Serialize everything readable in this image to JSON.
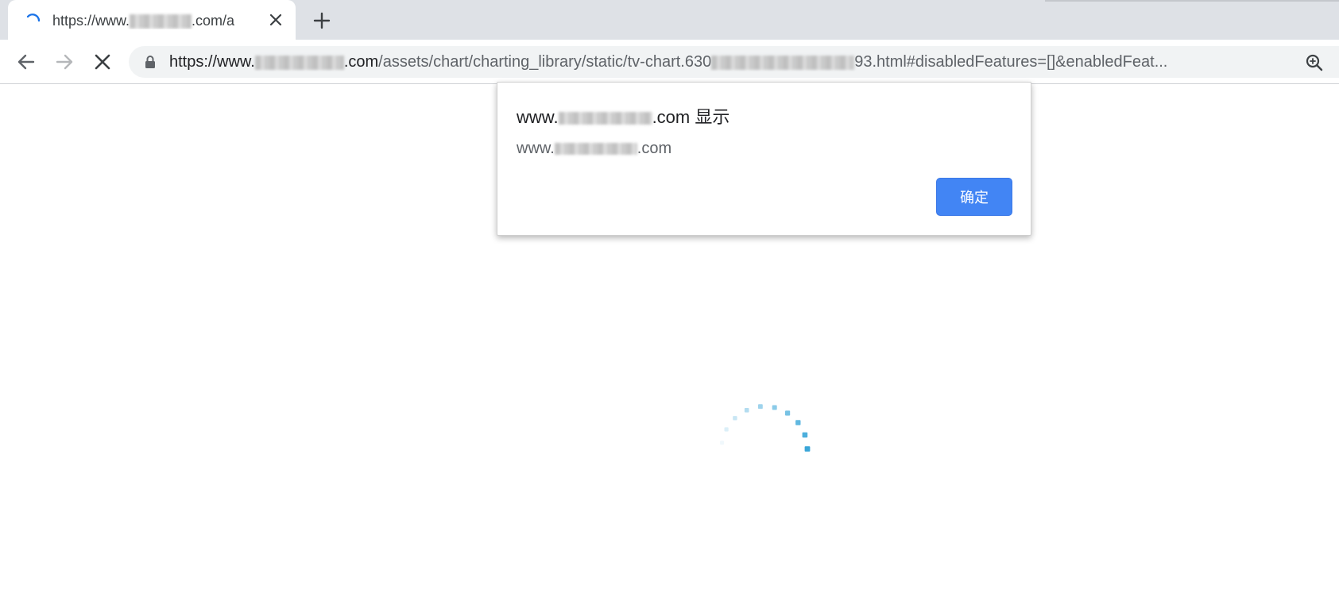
{
  "browser": {
    "tab": {
      "title_prefix": "https://www.",
      "title_suffix": ".com/a",
      "close_icon": "close-icon",
      "loading_icon": "loading-spinner-icon"
    },
    "new_tab_icon": "plus-icon",
    "nav": {
      "back_icon": "back-arrow-icon",
      "forward_icon": "forward-arrow-icon",
      "stop_icon": "stop-loading-icon"
    },
    "address": {
      "lock_icon": "lock-icon",
      "host_prefix": "https://www.",
      "host_suffix": ".com",
      "path_a": "/assets/chart/charting_library/static/tv-chart.630",
      "path_b": "93.html#disabledFeatures=[]&enabledFeat...",
      "zoom_icon": "zoom-icon"
    }
  },
  "dialog": {
    "title_prefix": "www.",
    "title_suffix": ".com 显示",
    "message_prefix": "www.",
    "message_suffix": ".com",
    "ok_label": "确定",
    "ok_color": "#4285f4"
  },
  "page": {
    "loading_indicator": "dotted-spinner-icon",
    "accent_color": "#3aa6d8"
  }
}
